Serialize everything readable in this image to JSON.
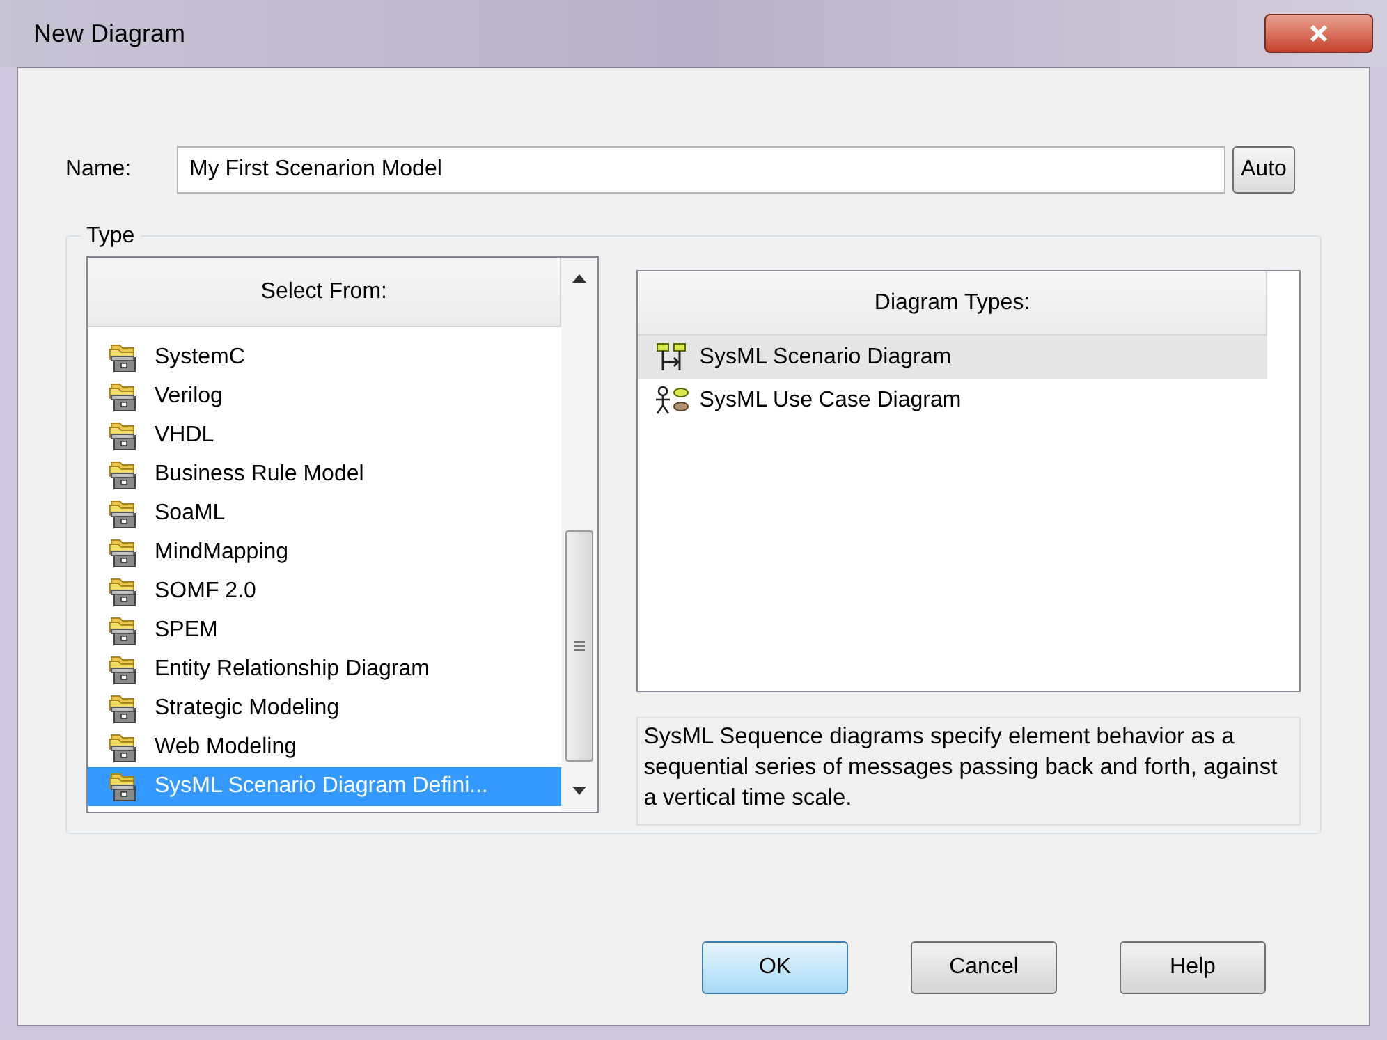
{
  "window": {
    "title": "New Diagram"
  },
  "name_field": {
    "label": "Name:",
    "value": "My First Scenarion Model",
    "button": "Auto"
  },
  "type_group": {
    "label": "Type",
    "select_from": {
      "header": "Select From:",
      "items": [
        {
          "label": "SystemC",
          "selected": false
        },
        {
          "label": "Verilog",
          "selected": false
        },
        {
          "label": "VHDL",
          "selected": false
        },
        {
          "label": "Business Rule Model",
          "selected": false
        },
        {
          "label": "SoaML",
          "selected": false
        },
        {
          "label": "MindMapping",
          "selected": false
        },
        {
          "label": "SOMF 2.0",
          "selected": false
        },
        {
          "label": "SPEM",
          "selected": false
        },
        {
          "label": "Entity Relationship Diagram",
          "selected": false
        },
        {
          "label": "Strategic Modeling",
          "selected": false
        },
        {
          "label": "Web Modeling",
          "selected": false
        },
        {
          "label": "SysML Scenario Diagram Defini...",
          "selected": true
        }
      ]
    },
    "diagram_types": {
      "header": "Diagram Types:",
      "items": [
        {
          "label": "SysML Scenario Diagram",
          "kind": "scenario",
          "selected": true
        },
        {
          "label": "SysML Use Case Diagram",
          "kind": "usecase",
          "selected": false
        }
      ]
    },
    "description": "SysML Sequence diagrams specify element behavior as a sequential series of messages passing back and forth, against a vertical time scale."
  },
  "buttons": [
    {
      "label": "OK",
      "default": true
    },
    {
      "label": "Cancel",
      "default": false
    },
    {
      "label": "Help",
      "default": false
    }
  ]
}
